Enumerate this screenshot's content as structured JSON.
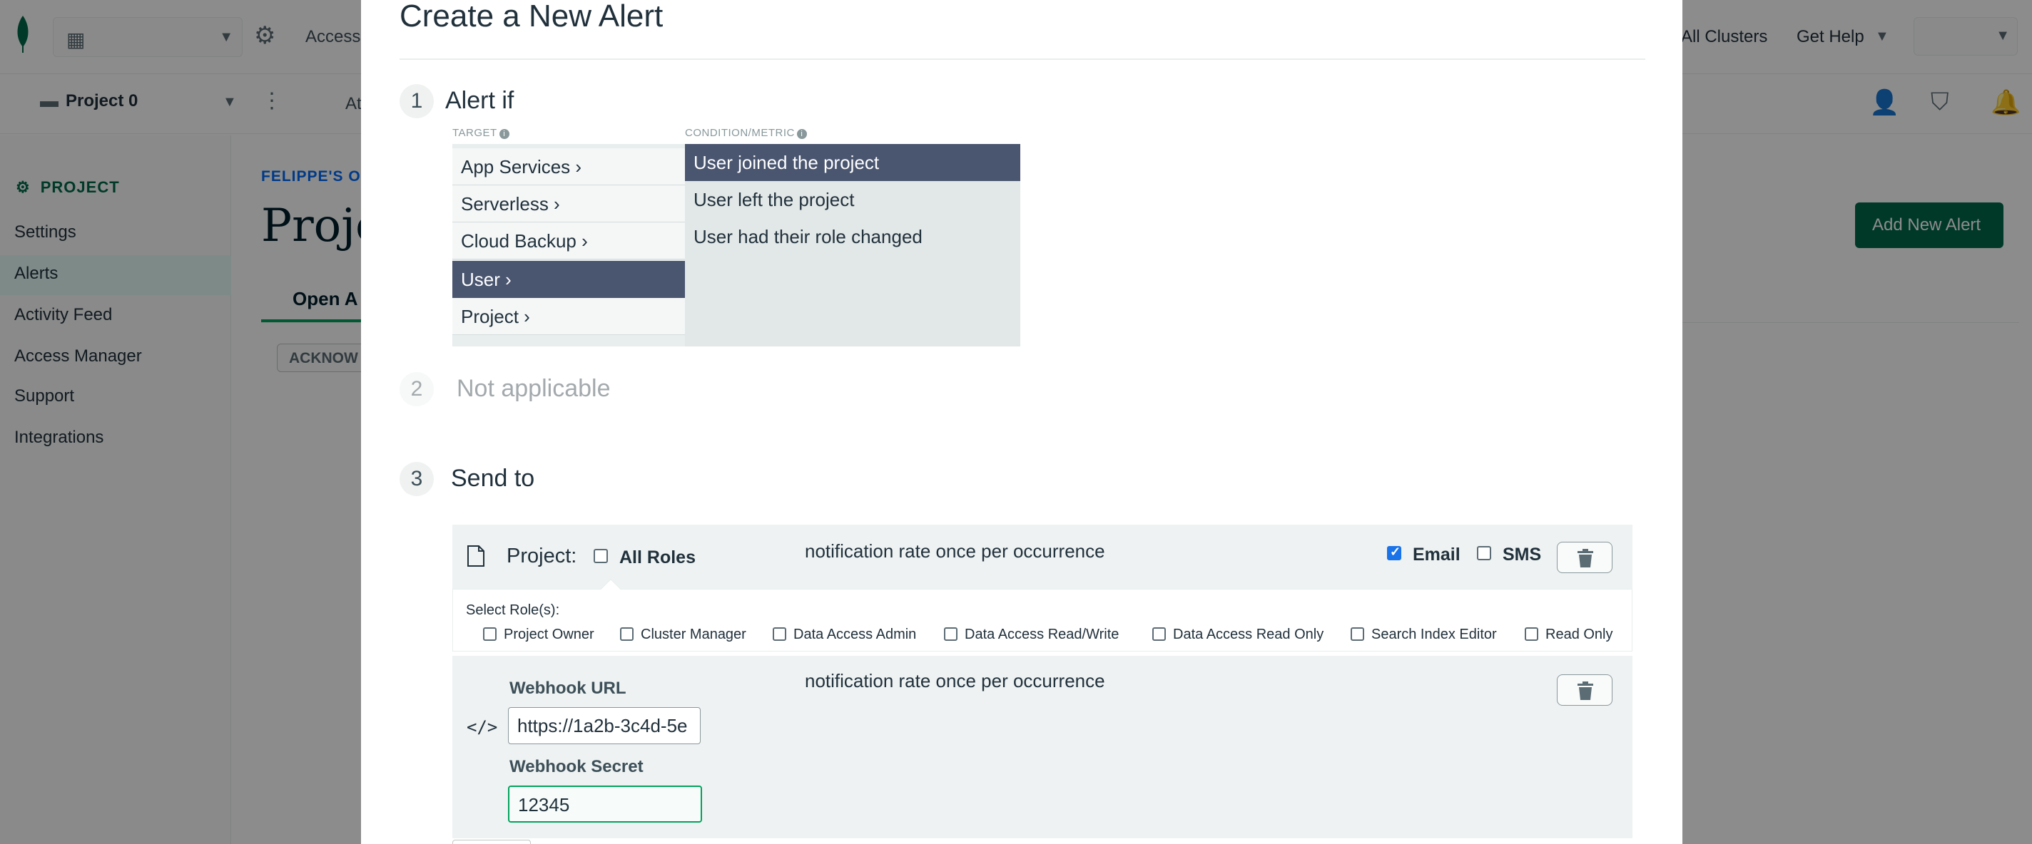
{
  "app": {
    "topbar": {
      "access_label": "Access",
      "all_clusters": "All Clusters",
      "get_help": "Get Help"
    },
    "subbar": {
      "project_name": "Project 0",
      "truncated_tab": "At"
    },
    "sidebar": {
      "section_title": "PROJECT",
      "items": [
        {
          "label": "Settings"
        },
        {
          "label": "Alerts"
        },
        {
          "label": "Activity Feed"
        },
        {
          "label": "Access Manager"
        },
        {
          "label": "Support"
        },
        {
          "label": "Integrations"
        }
      ]
    },
    "main": {
      "breadcrumb": "FELIPPE'S ORG",
      "page_title": "Project Alerts",
      "tab_open": "Open A",
      "acknowledge_button": "ACKNOW",
      "add_alert_button": "Add New Alert"
    }
  },
  "modal": {
    "title": "Create a New Alert",
    "step1": {
      "number": "1",
      "title": "Alert if",
      "target_label": "TARGET",
      "condition_label": "CONDITION/METRIC",
      "targets": [
        {
          "label": "App Services ›"
        },
        {
          "label": "Serverless ›"
        },
        {
          "label": "Cloud Backup ›"
        },
        {
          "label": "User ›"
        },
        {
          "label": "Project ›"
        }
      ],
      "selected_target": "User ›",
      "conditions": [
        {
          "label": "User joined the project"
        },
        {
          "label": "User left the project"
        },
        {
          "label": "User had their role changed"
        }
      ],
      "selected_condition": "User joined the project"
    },
    "step2": {
      "number": "2",
      "title": "Not applicable"
    },
    "step3": {
      "number": "3",
      "title": "Send to",
      "project_row": {
        "label": "Project:",
        "all_roles_label": "All Roles",
        "all_roles_checked": false,
        "rate_text": "notification rate once per occurrence",
        "email_label": "Email",
        "email_checked": true,
        "sms_label": "SMS",
        "sms_checked": false,
        "select_roles_label": "Select Role(s):",
        "roles": [
          {
            "label": "Project Owner"
          },
          {
            "label": "Cluster Manager"
          },
          {
            "label": "Data Access Admin"
          },
          {
            "label": "Data Access Read/Write"
          },
          {
            "label": "Data Access Read Only"
          },
          {
            "label": "Search Index Editor"
          },
          {
            "label": "Read Only"
          }
        ]
      },
      "webhook_row": {
        "url_label": "Webhook URL",
        "url_value": "https://1a2b-3c4d-5e",
        "secret_label": "Webhook Secret",
        "secret_value": "12345",
        "rate_text": "notification rate once per occurrence"
      }
    }
  },
  "colors": {
    "brand_green": "#00684a",
    "selected_item": "#4a5570",
    "accent_blue": "#016bf8",
    "focus_green": "#00a35c"
  },
  "icons": [
    "leaf-icon",
    "building-icon",
    "gear-icon",
    "folder-icon",
    "kebab-icon",
    "add-user-icon",
    "activity-icon",
    "bell-icon",
    "info-icon",
    "document-icon",
    "trash-icon",
    "code-icon"
  ]
}
